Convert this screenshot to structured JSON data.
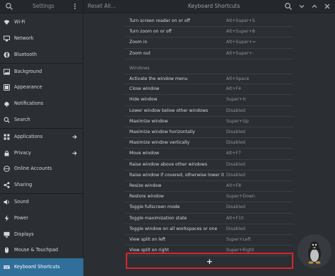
{
  "titlebar": {
    "app_title": "Settings",
    "reset_label": "Reset All...",
    "panel_title": "Keyboard Shortcuts"
  },
  "sidebar": {
    "items": [
      {
        "label": "Wi-Fi",
        "icon": "wifi-icon"
      },
      {
        "label": "Network",
        "icon": "network-icon"
      },
      {
        "label": "Bluetooth",
        "icon": "bluetooth-icon"
      },
      {
        "label": "Background",
        "icon": "background-icon"
      },
      {
        "label": "Appearance",
        "icon": "appearance-icon"
      },
      {
        "label": "Notifications",
        "icon": "notifications-icon"
      },
      {
        "label": "Search",
        "icon": "search-icon"
      },
      {
        "label": "Applications",
        "icon": "applications-icon"
      },
      {
        "label": "Privacy",
        "icon": "privacy-icon"
      },
      {
        "label": "Online Accounts",
        "icon": "online-accounts-icon"
      },
      {
        "label": "Sharing",
        "icon": "sharing-icon"
      },
      {
        "label": "Sound",
        "icon": "sound-icon"
      },
      {
        "label": "Power",
        "icon": "power-icon"
      },
      {
        "label": "Displays",
        "icon": "displays-icon"
      },
      {
        "label": "Mouse & Touchpad",
        "icon": "mouse-icon"
      },
      {
        "label": "Keyboard Shortcuts",
        "icon": "keyboard-icon"
      }
    ]
  },
  "shortcuts": {
    "accessibility_rows": [
      {
        "name": "Turn screen reader on or off",
        "accel": "Alt+Super+S"
      },
      {
        "name": "Turn zoom on or off",
        "accel": "Alt+Super+8"
      },
      {
        "name": "Zoom in",
        "accel": "Alt+Super+="
      },
      {
        "name": "Zoom out",
        "accel": "Alt+Super+-"
      }
    ],
    "windows_heading": "Windows",
    "windows_rows": [
      {
        "name": "Activate the window menu",
        "accel": "Alt+Space"
      },
      {
        "name": "Close window",
        "accel": "Alt+F4"
      },
      {
        "name": "Hide window",
        "accel": "Super+H"
      },
      {
        "name": "Lower window below other windows",
        "accel": "Disabled"
      },
      {
        "name": "Maximize window",
        "accel": "Super+Up"
      },
      {
        "name": "Maximize window horizontally",
        "accel": "Disabled"
      },
      {
        "name": "Maximize window vertically",
        "accel": "Disabled"
      },
      {
        "name": "Move window",
        "accel": "Alt+F7"
      },
      {
        "name": "Raise window above other windows",
        "accel": "Disabled"
      },
      {
        "name": "Raise window if covered, otherwise lower it",
        "accel": "Disabled"
      },
      {
        "name": "Resize window",
        "accel": "Alt+F8"
      },
      {
        "name": "Restore window",
        "accel": "Super+Down"
      },
      {
        "name": "Toggle fullscreen mode",
        "accel": "Disabled"
      },
      {
        "name": "Toggle maximization state",
        "accel": "Alt+F10"
      },
      {
        "name": "Toggle window on all workspaces or one",
        "accel": "Disabled"
      },
      {
        "name": "View split on left",
        "accel": "Super+Left"
      },
      {
        "name": "View split on right",
        "accel": "Super+Right"
      }
    ],
    "add_label": "+"
  },
  "colors": {
    "accent": "#2f6f9a",
    "highlight_border": "#d9252b"
  }
}
